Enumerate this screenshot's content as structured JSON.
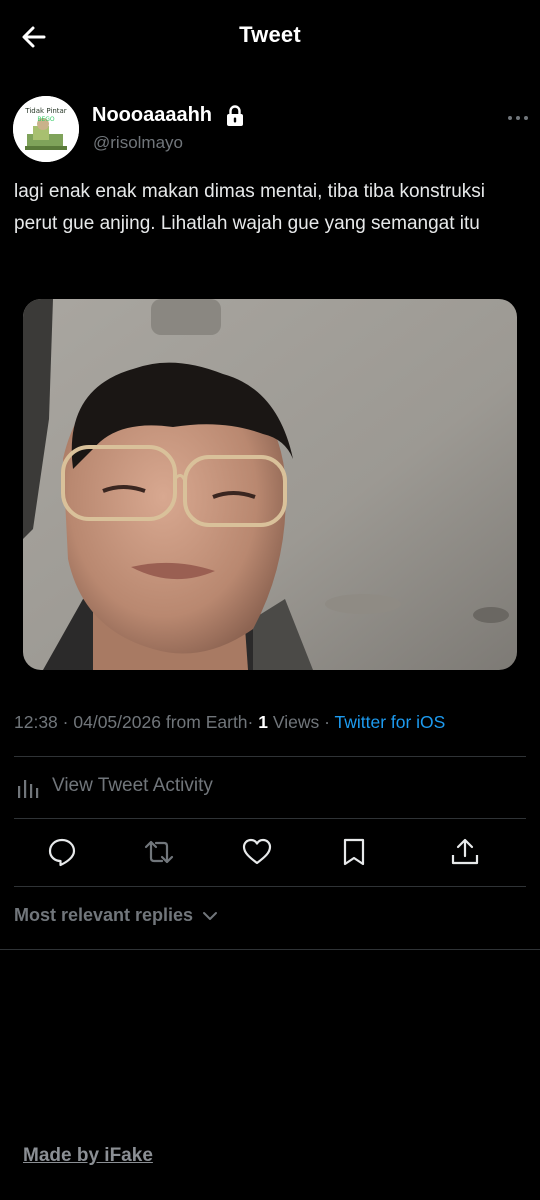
{
  "header": {
    "title": "Tweet",
    "back_icon": "arrow-left-icon"
  },
  "author": {
    "display_name": "Noooaaaahh",
    "handle": "@risolmayo",
    "protected_icon": "lock-icon",
    "avatar_text_line1": "Tidak Pintar",
    "avatar_text_line2": "BEGO"
  },
  "tweet": {
    "text": "lagi enak enak makan dimas mentai, tiba tiba konstruksi perut gue anjing. Lihatlah wajah gue yang semangat itu",
    "time": "12:38",
    "date": "04/05/2026",
    "location": "from Earth",
    "views_count": "1",
    "views_label": "Views",
    "source": "Twitter for iOS",
    "separator": "·",
    "media_description_icon": "photo"
  },
  "activity": {
    "label": "View Tweet Activity",
    "icon": "analytics-bars-icon"
  },
  "actions": [
    {
      "name": "reply",
      "icon": "reply-bubble-icon"
    },
    {
      "name": "retweet",
      "icon": "retweet-icon"
    },
    {
      "name": "like",
      "icon": "heart-icon"
    },
    {
      "name": "bookmark",
      "icon": "bookmark-icon"
    },
    {
      "name": "share",
      "icon": "share-icon"
    }
  ],
  "replies": {
    "label": "Most relevant replies",
    "icon": "chevron-down-icon"
  },
  "watermark": {
    "label": "Made by iFake"
  },
  "colors": {
    "background": "#000000",
    "text_primary": "#e7e9ea",
    "text_secondary": "#71767b",
    "link": "#1d9bf0",
    "divider": "#2f3336"
  }
}
